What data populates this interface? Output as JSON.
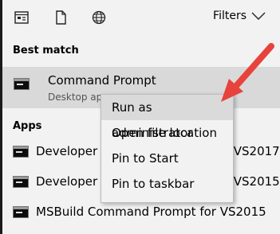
{
  "toolbar": {
    "icons": [
      "apps-icon",
      "document-icon",
      "web-globe-icon"
    ],
    "filters_label": "Filters"
  },
  "best_match": {
    "heading": "Best match",
    "title": "Command Prompt",
    "subtitle": "Desktop app"
  },
  "apps": {
    "heading": "Apps",
    "items": [
      {
        "label": "Developer Command Prompt for VS2017"
      },
      {
        "label": "Developer Command Prompt for VS2015"
      },
      {
        "label": "MSBuild Command Prompt for VS2015"
      }
    ]
  },
  "context_menu": {
    "items": [
      {
        "label": "Run as administrator",
        "highlighted": true
      },
      {
        "label": "Open file location"
      },
      {
        "label": "Pin to Start"
      },
      {
        "label": "Pin to taskbar"
      }
    ]
  },
  "annotation": {
    "color": "#e8423c",
    "icon": "red-arrow"
  }
}
